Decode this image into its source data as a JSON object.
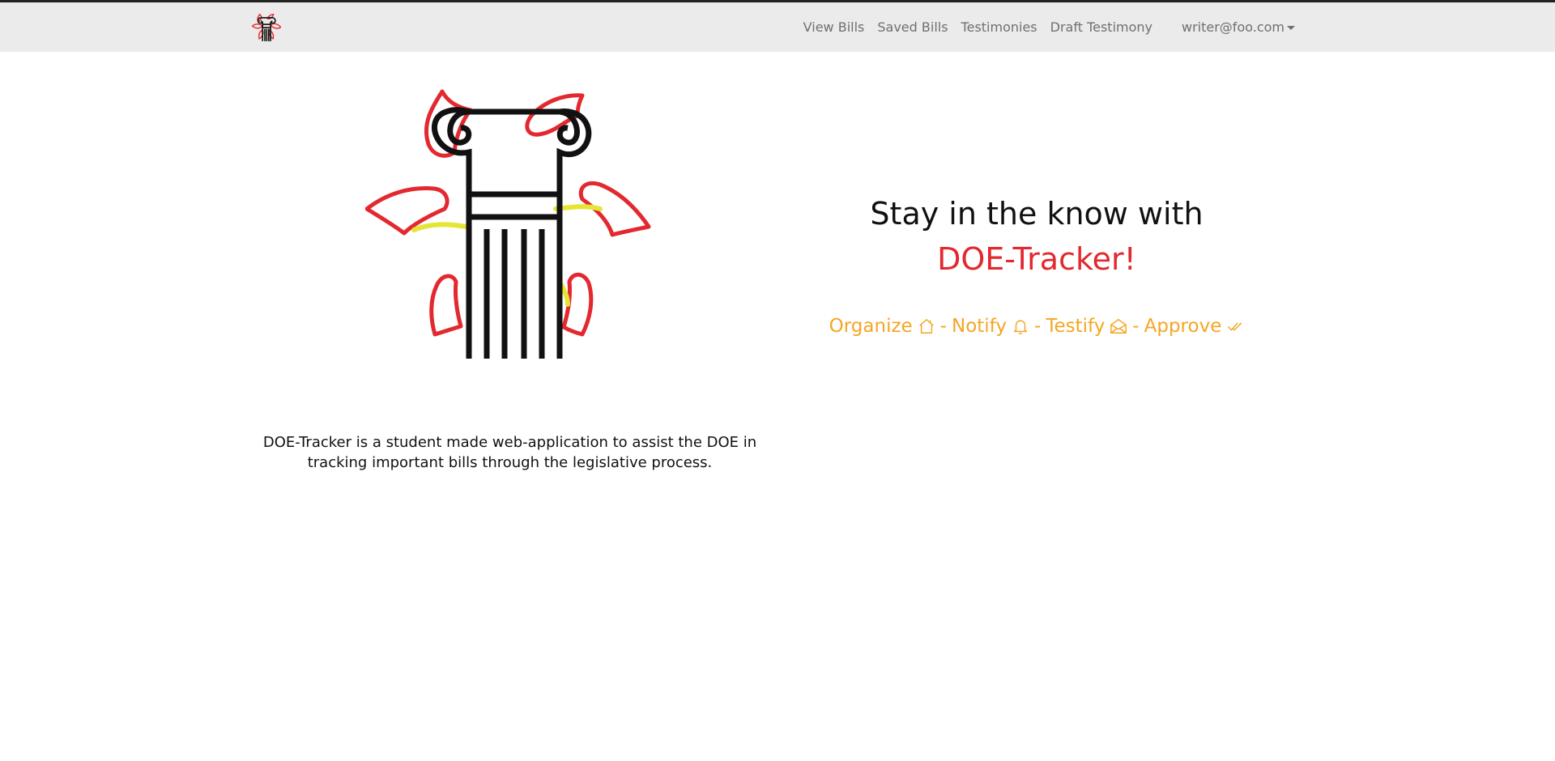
{
  "navbar": {
    "brand_icon": "doe-tracker-logo-icon",
    "links": [
      {
        "label": "View Bills"
      },
      {
        "label": "Saved Bills"
      },
      {
        "label": "Testimonies"
      },
      {
        "label": "Draft Testimony"
      }
    ],
    "user": {
      "email": "writer@foo.com",
      "icon": "caret-down-icon"
    }
  },
  "hero": {
    "logo_icon": "doe-tracker-pillar-flower-logo",
    "headline": "Stay in the know with",
    "brand_name": "DOE-Tracker!",
    "features": [
      {
        "label": "Organize",
        "icon": "house-icon"
      },
      {
        "separator": "-"
      },
      {
        "label": "Notify",
        "icon": "bell-icon"
      },
      {
        "separator": "-"
      },
      {
        "label": "Testify",
        "icon": "envelope-open-icon"
      },
      {
        "separator": "-"
      },
      {
        "label": "Approve",
        "icon": "check-all-icon"
      }
    ],
    "description": "DOE-Tracker is a student made web-application to assist the DOE in tracking important bills through the legislative process."
  },
  "colors": {
    "brand_red": "#e3282f",
    "accent_orange": "#f5a623",
    "navbar_bg": "#ebebeb",
    "logo_yellow": "#e5e535"
  }
}
